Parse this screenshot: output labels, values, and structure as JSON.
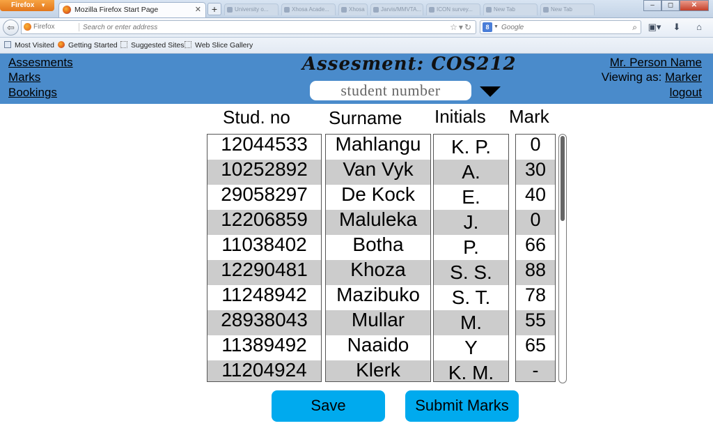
{
  "browser": {
    "menu_button": "Firefox",
    "active_tab": "Mozilla Firefox Start Page",
    "background_tabs": [
      "University o...",
      "Xhosa Acade...",
      "Xhosa",
      "Jarvis/MMVTA...",
      "ICON survey...",
      "New Tab",
      "New Tab"
    ],
    "window_controls": {
      "minimize": "–",
      "maximize": "◻",
      "close": "✕"
    },
    "identity_label": "Firefox",
    "url_placeholder": "Search or enter address",
    "search_engine": "8",
    "search_placeholder": "Google",
    "bookmarks": [
      "Most Visited",
      "Getting Started",
      "Suggested Sites",
      "Web Slice Gallery"
    ]
  },
  "header": {
    "nav": {
      "assessments": "Assesments",
      "marks": "Marks",
      "bookings": "Bookings"
    },
    "title": "Assesment: COS212",
    "student_select": "student number",
    "user_name": "Mr. Person Name",
    "viewing_as_label": "Viewing as:",
    "viewing_as_role": "Marker",
    "logout": "logout",
    "color": "#4a8bcb"
  },
  "table": {
    "headers": {
      "stud_no": "Stud. no",
      "surname": "Surname",
      "initials": "Initials",
      "mark": "Mark"
    },
    "stud_no": [
      "12044533",
      "10252892",
      "29058297",
      "12206859",
      "11038402",
      "12290481",
      "11248942",
      "28938043",
      "11389492",
      "11204924"
    ],
    "surname": [
      "Mahlangu",
      "Van Vyk",
      "De Kock",
      "Maluleka",
      "Botha",
      "Khoza",
      "Mazibuko",
      "Mullar",
      "Naaido",
      "Klerk"
    ],
    "initials": [
      "K. P.",
      "A.",
      "E.",
      "J.",
      "P.",
      "S. S.",
      "S. T.",
      "M.",
      "Y",
      "K. M."
    ],
    "mark": [
      "0",
      "30",
      "40",
      "0",
      "66",
      "88",
      "78",
      "55",
      "65",
      "-"
    ]
  },
  "actions": {
    "save": "Save",
    "submit": "Submit Marks",
    "color": "#00aaee"
  }
}
